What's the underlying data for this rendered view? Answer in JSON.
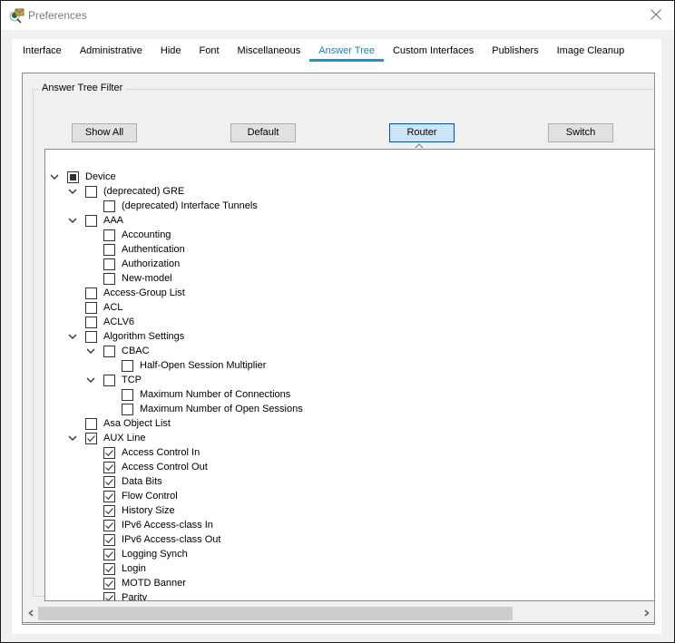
{
  "window": {
    "title": "Preferences",
    "icon": "packet-tracer-preferences-icon",
    "close_icon": "close-icon"
  },
  "tabs": [
    {
      "label": "Interface",
      "active": false
    },
    {
      "label": "Administrative",
      "active": false
    },
    {
      "label": "Hide",
      "active": false
    },
    {
      "label": "Font",
      "active": false
    },
    {
      "label": "Miscellaneous",
      "active": false
    },
    {
      "label": "Answer Tree",
      "active": true
    },
    {
      "label": "Custom Interfaces",
      "active": false
    },
    {
      "label": "Publishers",
      "active": false
    },
    {
      "label": "Image Cleanup",
      "active": false
    }
  ],
  "filter": {
    "group_label": "Answer Tree Filter",
    "buttons": [
      {
        "label": "Show All",
        "selected": false
      },
      {
        "label": "Default",
        "selected": false
      },
      {
        "label": "Router",
        "selected": true
      },
      {
        "label": "Switch",
        "selected": false
      }
    ]
  },
  "tree": [
    {
      "label": "Device",
      "level": 0,
      "expandable": true,
      "state": "partial"
    },
    {
      "label": "(deprecated) GRE",
      "level": 1,
      "expandable": true,
      "state": "unchecked"
    },
    {
      "label": "(deprecated) Interface Tunnels",
      "level": 2,
      "expandable": false,
      "state": "unchecked"
    },
    {
      "label": "AAA",
      "level": 1,
      "expandable": true,
      "state": "unchecked"
    },
    {
      "label": "Accounting",
      "level": 2,
      "expandable": false,
      "state": "unchecked"
    },
    {
      "label": "Authentication",
      "level": 2,
      "expandable": false,
      "state": "unchecked"
    },
    {
      "label": "Authorization",
      "level": 2,
      "expandable": false,
      "state": "unchecked"
    },
    {
      "label": "New-model",
      "level": 2,
      "expandable": false,
      "state": "unchecked"
    },
    {
      "label": "Access-Group List",
      "level": 1,
      "expandable": false,
      "state": "unchecked"
    },
    {
      "label": "ACL",
      "level": 1,
      "expandable": false,
      "state": "unchecked"
    },
    {
      "label": "ACLV6",
      "level": 1,
      "expandable": false,
      "state": "unchecked"
    },
    {
      "label": "Algorithm Settings",
      "level": 1,
      "expandable": true,
      "state": "unchecked"
    },
    {
      "label": "CBAC",
      "level": 2,
      "expandable": true,
      "state": "unchecked"
    },
    {
      "label": "Half-Open Session Multiplier",
      "level": 3,
      "expandable": false,
      "state": "unchecked"
    },
    {
      "label": "TCP",
      "level": 2,
      "expandable": true,
      "state": "unchecked"
    },
    {
      "label": "Maximum Number of Connections",
      "level": 3,
      "expandable": false,
      "state": "unchecked"
    },
    {
      "label": "Maximum Number of Open Sessions",
      "level": 3,
      "expandable": false,
      "state": "unchecked"
    },
    {
      "label": "Asa Object List",
      "level": 1,
      "expandable": false,
      "state": "unchecked"
    },
    {
      "label": "AUX Line",
      "level": 1,
      "expandable": true,
      "state": "checked"
    },
    {
      "label": "Access Control In",
      "level": 2,
      "expandable": false,
      "state": "checked"
    },
    {
      "label": "Access Control Out",
      "level": 2,
      "expandable": false,
      "state": "checked"
    },
    {
      "label": "Data Bits",
      "level": 2,
      "expandable": false,
      "state": "checked"
    },
    {
      "label": "Flow Control",
      "level": 2,
      "expandable": false,
      "state": "checked"
    },
    {
      "label": "History Size",
      "level": 2,
      "expandable": false,
      "state": "checked"
    },
    {
      "label": "IPv6 Access-class In",
      "level": 2,
      "expandable": false,
      "state": "checked"
    },
    {
      "label": "IPv6 Access-class Out",
      "level": 2,
      "expandable": false,
      "state": "checked"
    },
    {
      "label": "Logging Synch",
      "level": 2,
      "expandable": false,
      "state": "checked"
    },
    {
      "label": "Login",
      "level": 2,
      "expandable": false,
      "state": "checked"
    },
    {
      "label": "MOTD Banner",
      "level": 2,
      "expandable": false,
      "state": "checked"
    },
    {
      "label": "Parity",
      "level": 2,
      "expandable": false,
      "state": "checked"
    }
  ],
  "scrollbar": {
    "horizontal_position": 0,
    "visible_fraction": 0.79
  },
  "colors": {
    "accent": "#1a96cf",
    "active_tab_text": "#1a85c6",
    "selected_button_bg": "#cce4f7",
    "selected_button_border": "#005499"
  }
}
